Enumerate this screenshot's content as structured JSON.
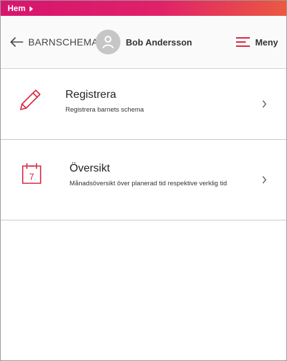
{
  "topbar": {
    "home_label": "Hem"
  },
  "header": {
    "back_title": "BARNSCHEMA",
    "user_name": "Bob Andersson",
    "menu_label": "Meny"
  },
  "items": [
    {
      "title": "Registrera",
      "description": "Registrera barnets schema",
      "icon": "pencil-icon"
    },
    {
      "title": "Översikt",
      "description": "Månadsöversikt över planerad tid respektive verklig tid",
      "icon": "calendar-icon",
      "calendar_day": "7"
    }
  ],
  "colors": {
    "brand": "#e0206a",
    "brand_end": "#ea5a40",
    "icon_red": "#d7263d"
  }
}
